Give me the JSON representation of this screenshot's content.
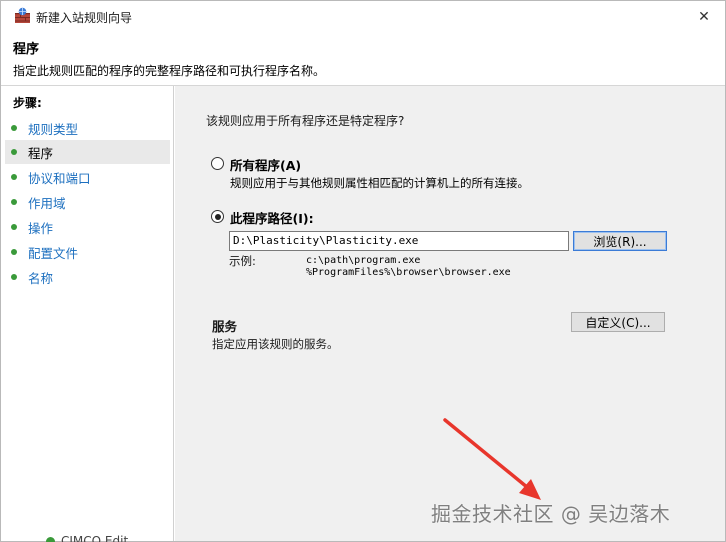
{
  "window": {
    "title": "新建入站规则向导",
    "close_glyph": "✕"
  },
  "header": {
    "title": "程序",
    "description": "指定此规则匹配的程序的完整程序路径和可执行程序名称。"
  },
  "steps": {
    "label": "步骤:",
    "items": [
      {
        "label": "规则类型",
        "active": false
      },
      {
        "label": "程序",
        "active": true
      },
      {
        "label": "协议和端口",
        "active": false
      },
      {
        "label": "作用域",
        "active": false
      },
      {
        "label": "操作",
        "active": false
      },
      {
        "label": "配置文件",
        "active": false
      },
      {
        "label": "名称",
        "active": false
      }
    ]
  },
  "content": {
    "question": "该规则应用于所有程序还是特定程序?",
    "all_programs": {
      "label": "所有程序(A)",
      "description": "规则应用于与其他规则属性相匹配的计算机上的所有连接。",
      "selected": false
    },
    "program_path": {
      "label": "此程序路径(I):",
      "value": "D:\\Plasticity\\Plasticity.exe",
      "browse_label": "浏览(R)...",
      "selected": true
    },
    "example": {
      "label": "示例:",
      "lines": [
        "c:\\path\\program.exe",
        "%ProgramFiles%\\browser\\browser.exe"
      ]
    },
    "services": {
      "title": "服务",
      "description": "指定应用该规则的服务。",
      "customize_label": "自定义(C)..."
    }
  },
  "overlay": {
    "watermark": "掘金技术社区 @ 吴边落木",
    "background_peek": "CIMCO Edit"
  },
  "colors": {
    "accent_link": "#1c6fbf",
    "step_dot": "#3a9a3a",
    "arrow": "#e8362c",
    "content_bg": "#f0f0f0"
  }
}
